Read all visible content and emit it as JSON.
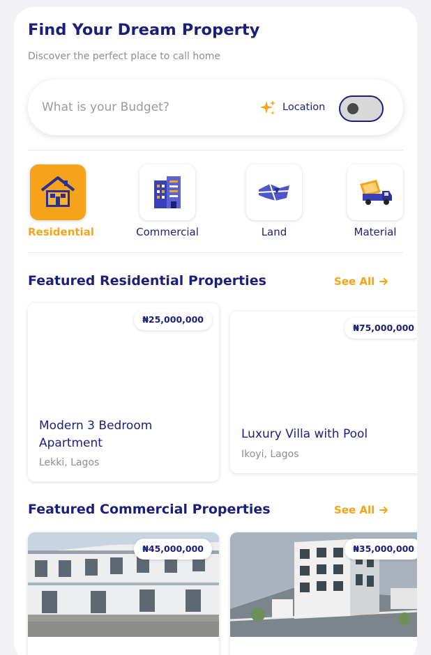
{
  "header": {
    "title": "Find Your Dream Property",
    "subtitle": "Discover the perfect place to call home"
  },
  "search": {
    "placeholder": "What is your Budget?",
    "location_label": "Location",
    "location_toggle_on": false
  },
  "categories": [
    {
      "label": "Residential",
      "icon": "house-icon",
      "active": true
    },
    {
      "label": "Commercial",
      "icon": "building-icon",
      "active": false
    },
    {
      "label": "Land",
      "icon": "land-plot-icon",
      "active": false
    },
    {
      "label": "Material",
      "icon": "truck-icon",
      "active": false
    }
  ],
  "residential": {
    "title": "Featured Residential Properties",
    "see_all": "See All",
    "cards": [
      {
        "price": "₦25,000,000",
        "title": "Modern 3 Bedroom Apartment",
        "location": "Lekki, Lagos"
      },
      {
        "price": "₦75,000,000",
        "title": "Luxury Villa with Pool",
        "location": "Ikoyi, Lagos"
      }
    ]
  },
  "commercial": {
    "title": "Featured Commercial Properties",
    "see_all": "See All",
    "cards": [
      {
        "price": "₦45,000,000",
        "image": "terraced-townhouses-photo"
      },
      {
        "price": "₦35,000,000",
        "image": "apartment-block-render"
      }
    ]
  },
  "colors": {
    "primary": "#1c1f7a",
    "accent": "#f5a31a",
    "muted": "#8d8d94"
  }
}
